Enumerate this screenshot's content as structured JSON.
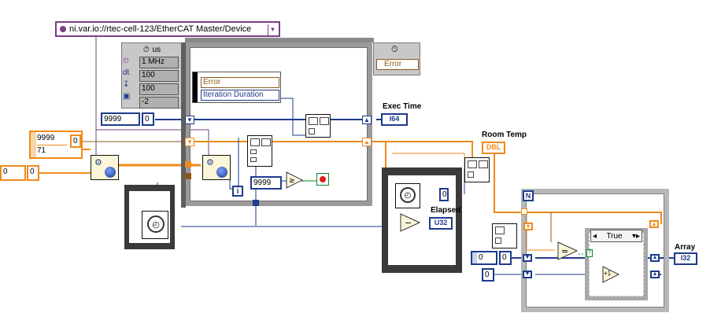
{
  "resource": {
    "path": "ni.var.io://rtec-cell-123/EtherCAT Master/Device"
  },
  "timing_config": {
    "unit": "us",
    "rows": [
      {
        "icon": "clock-source-icon",
        "value": "1 MHz"
      },
      {
        "icon": "dt-icon",
        "label": "dt",
        "value": "100"
      },
      {
        "icon": "offset-icon",
        "value": "100"
      },
      {
        "icon": "cpu-icon",
        "value": "-2"
      }
    ]
  },
  "timed_loop": {
    "left_node": {
      "items": [
        "Error",
        "Iteration Duration"
      ]
    },
    "right_node": {
      "items": [
        "Error"
      ]
    },
    "priority_value": "9999",
    "priority_const": "0",
    "stop_value": "9999",
    "iteration_label": "i"
  },
  "left_inputs": {
    "array_values": [
      "9999",
      "71"
    ],
    "array_index": "0",
    "index2": "0",
    "index2b": "0"
  },
  "indicators": {
    "exec_time": {
      "label": "Exec Time",
      "type": "I64"
    },
    "room_temp": {
      "label": "Room Temp",
      "type": "DBL"
    },
    "elapsed": {
      "label": "Elapsed",
      "type": "U32"
    },
    "array": {
      "label": "Array",
      "type": "I32"
    }
  },
  "flat_sequence": {
    "elapsed_const": "0"
  },
  "for_loop": {
    "count_label": "N",
    "case_value": "True",
    "increment_label": "+1",
    "array_ctrl_index": "0",
    "array_ctrl_value": "0",
    "init_value": "0"
  },
  "colors": {
    "integer_wire": "#1e3b8c",
    "float_wire": "#f08a1c",
    "cluster_wire": "#8a5a1a",
    "path_wire": "#7a3e86",
    "loop_gray": "#9a9a9a"
  }
}
